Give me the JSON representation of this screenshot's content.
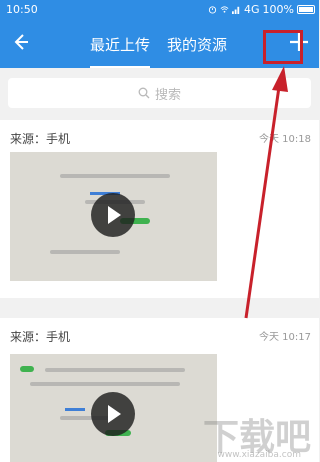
{
  "status_bar": {
    "time": "10:50",
    "network": "4G",
    "battery": "100%"
  },
  "header": {
    "tabs": [
      {
        "label": "最近上传",
        "active": true
      },
      {
        "label": "我的资源",
        "active": false
      }
    ]
  },
  "search": {
    "placeholder": "搜索"
  },
  "items": [
    {
      "source": "来源：手机",
      "time": "今天 10:18"
    },
    {
      "source": "来源：手机",
      "time": "今天 10:17"
    }
  ],
  "watermark": {
    "text": "下载吧",
    "url": "www.xiazaiba.com"
  },
  "colors": {
    "primary": "#2f8de4",
    "annotation": "#c8212b",
    "background": "#f1f1f1"
  },
  "icons": {
    "back": "arrow-left-icon",
    "add": "plus-icon",
    "search": "search-icon",
    "play": "play-icon"
  }
}
